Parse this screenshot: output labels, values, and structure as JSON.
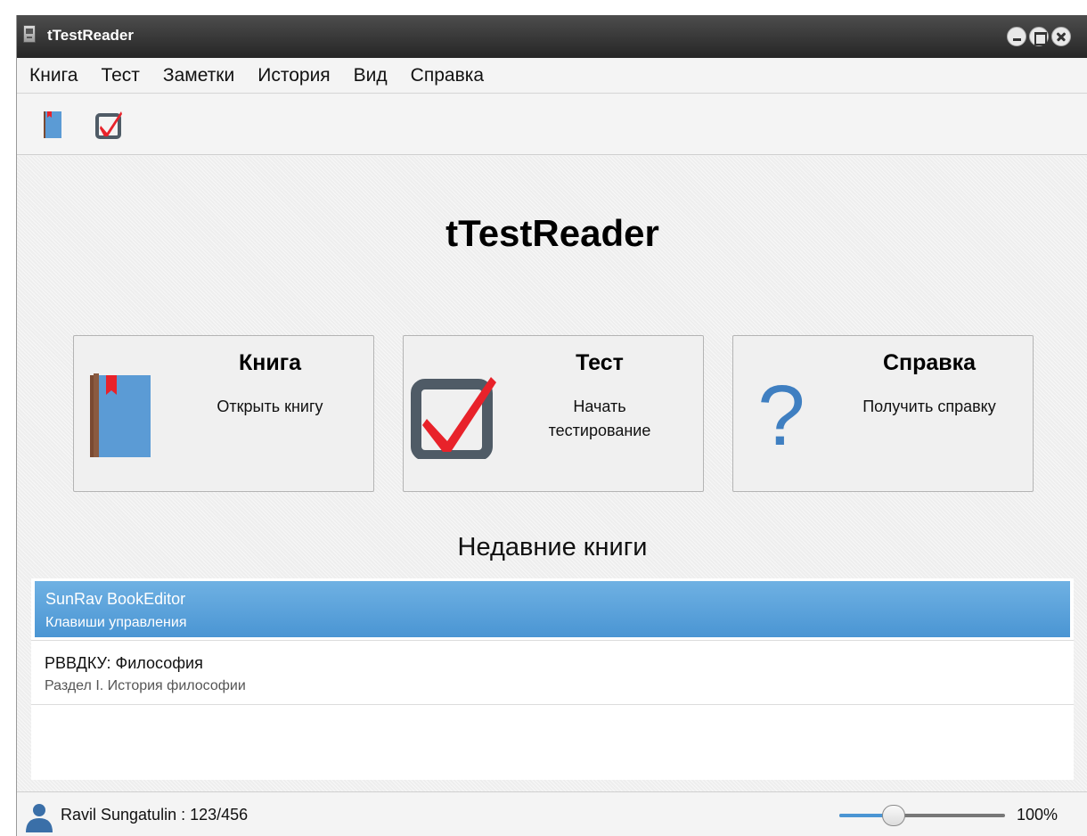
{
  "window": {
    "title": "tTestReader"
  },
  "menu": [
    "Книга",
    "Тест",
    "Заметки",
    "История",
    "Вид",
    "Справка"
  ],
  "main_title": "tTestReader",
  "cards": {
    "book": {
      "title": "Книга",
      "desc": "Открыть книгу"
    },
    "test": {
      "title": "Тест",
      "desc1": "Начать",
      "desc2": "тестирование"
    },
    "help": {
      "title": "Справка",
      "desc": "Получить справку",
      "glyph": "?"
    }
  },
  "recent": {
    "heading": "Недавние книги",
    "items": [
      {
        "title": "SunRav BookEditor",
        "subtitle": "Клавиши управления",
        "selected": true
      },
      {
        "title": "РВВДКУ: Философия",
        "subtitle": "Раздел I. История философии",
        "selected": false
      }
    ]
  },
  "status": {
    "user": "Ravil Sungatulin : 123/456",
    "zoom_label": "100%",
    "zoom_slider_fraction": 0.3
  },
  "colors": {
    "accent": "#4a95d3",
    "checkmark": "#e8222a",
    "book": "#5b9bd5",
    "question": "#3f7fc1",
    "checkbox_frame": "#4f5b66"
  }
}
